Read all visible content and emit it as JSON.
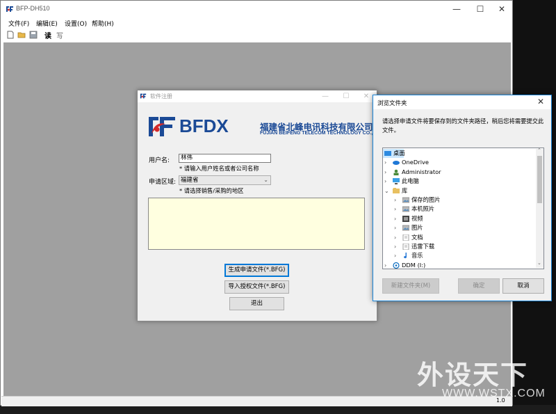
{
  "main_window": {
    "title": "BFP-DH510",
    "caption_buttons": {
      "minimize": "—",
      "maximize": "☐",
      "close": "✕"
    },
    "menu": [
      "文件(F)",
      "编辑(E)",
      "设置(O)",
      "帮助(H)"
    ],
    "toolbar": {
      "read_label": "读",
      "write_label": "写"
    },
    "status_version": "1.0"
  },
  "reg_dialog": {
    "title": "软件注册",
    "logo": {
      "mark": "BFDX",
      "cn": "福建省北峰电讯科技有限公司",
      "en": "FUJIAN BEIFENG TELECOM TECHNOLOGY CO.,LTD"
    },
    "username_label": "用户名:",
    "username_value": "林伟",
    "username_hint": "* 请输入用户姓名或者公司名称",
    "region_label": "申请区域:",
    "region_value": "福建省",
    "region_hint": "* 请选择销售/采购的地区",
    "btn_generate": "生成申请文件(*.BFG)",
    "btn_import": "导入授权文件(*.BFG)",
    "btn_exit": "退出"
  },
  "browse_dialog": {
    "title": "浏览文件夹",
    "description": "请选择申请文件将要保存到的文件夹路径，稍后您将需要提交此文件。",
    "tree": [
      {
        "label": "桌面",
        "icon": "desktop-folder-icon",
        "level": 0,
        "expander": "",
        "selected": true
      },
      {
        "label": "OneDrive",
        "icon": "cloud-icon",
        "level": 1,
        "expander": "›"
      },
      {
        "label": "Administrator",
        "icon": "user-icon",
        "level": 1,
        "expander": "›"
      },
      {
        "label": "此电脑",
        "icon": "computer-icon",
        "level": 1,
        "expander": "›"
      },
      {
        "label": "库",
        "icon": "library-icon",
        "level": 1,
        "expander": "⌄"
      },
      {
        "label": "保存的图片",
        "icon": "pictures-icon",
        "level": 2,
        "expander": "›"
      },
      {
        "label": "本机照片",
        "icon": "pictures-icon",
        "level": 2,
        "expander": "›"
      },
      {
        "label": "视频",
        "icon": "video-icon",
        "level": 2,
        "expander": "›"
      },
      {
        "label": "图片",
        "icon": "pictures-icon",
        "level": 2,
        "expander": "›"
      },
      {
        "label": "文档",
        "icon": "document-icon",
        "level": 2,
        "expander": "›"
      },
      {
        "label": "迅雷下载",
        "icon": "document-icon",
        "level": 2,
        "expander": "›"
      },
      {
        "label": "音乐",
        "icon": "music-icon",
        "level": 2,
        "expander": "›"
      },
      {
        "label": "DDM (I:)",
        "icon": "drive-icon",
        "level": 1,
        "expander": "›"
      }
    ],
    "btn_new_folder": "新建文件夹(M)",
    "btn_ok": "确定",
    "btn_cancel": "取消"
  },
  "watermark": {
    "cn": "外设天下",
    "en": "WWW.WSTX.COM"
  }
}
